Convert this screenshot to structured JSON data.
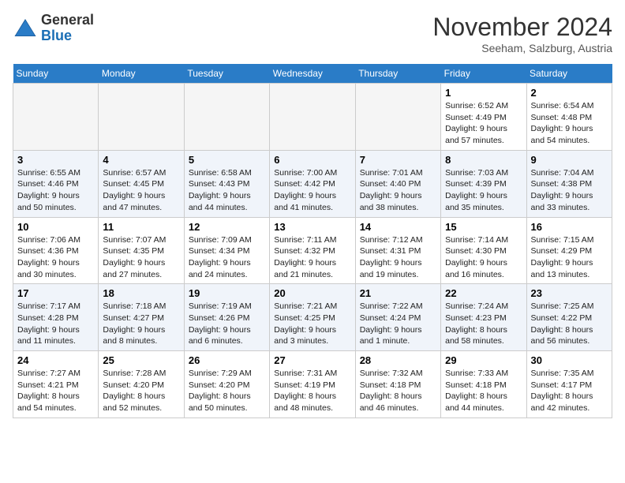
{
  "header": {
    "logo": {
      "general": "General",
      "blue": "Blue"
    },
    "title": "November 2024",
    "location": "Seeham, Salzburg, Austria"
  },
  "days_of_week": [
    "Sunday",
    "Monday",
    "Tuesday",
    "Wednesday",
    "Thursday",
    "Friday",
    "Saturday"
  ],
  "weeks": [
    [
      {
        "day": "",
        "info": ""
      },
      {
        "day": "",
        "info": ""
      },
      {
        "day": "",
        "info": ""
      },
      {
        "day": "",
        "info": ""
      },
      {
        "day": "",
        "info": ""
      },
      {
        "day": "1",
        "info": "Sunrise: 6:52 AM\nSunset: 4:49 PM\nDaylight: 9 hours\nand 57 minutes."
      },
      {
        "day": "2",
        "info": "Sunrise: 6:54 AM\nSunset: 4:48 PM\nDaylight: 9 hours\nand 54 minutes."
      }
    ],
    [
      {
        "day": "3",
        "info": "Sunrise: 6:55 AM\nSunset: 4:46 PM\nDaylight: 9 hours\nand 50 minutes."
      },
      {
        "day": "4",
        "info": "Sunrise: 6:57 AM\nSunset: 4:45 PM\nDaylight: 9 hours\nand 47 minutes."
      },
      {
        "day": "5",
        "info": "Sunrise: 6:58 AM\nSunset: 4:43 PM\nDaylight: 9 hours\nand 44 minutes."
      },
      {
        "day": "6",
        "info": "Sunrise: 7:00 AM\nSunset: 4:42 PM\nDaylight: 9 hours\nand 41 minutes."
      },
      {
        "day": "7",
        "info": "Sunrise: 7:01 AM\nSunset: 4:40 PM\nDaylight: 9 hours\nand 38 minutes."
      },
      {
        "day": "8",
        "info": "Sunrise: 7:03 AM\nSunset: 4:39 PM\nDaylight: 9 hours\nand 35 minutes."
      },
      {
        "day": "9",
        "info": "Sunrise: 7:04 AM\nSunset: 4:38 PM\nDaylight: 9 hours\nand 33 minutes."
      }
    ],
    [
      {
        "day": "10",
        "info": "Sunrise: 7:06 AM\nSunset: 4:36 PM\nDaylight: 9 hours\nand 30 minutes."
      },
      {
        "day": "11",
        "info": "Sunrise: 7:07 AM\nSunset: 4:35 PM\nDaylight: 9 hours\nand 27 minutes."
      },
      {
        "day": "12",
        "info": "Sunrise: 7:09 AM\nSunset: 4:34 PM\nDaylight: 9 hours\nand 24 minutes."
      },
      {
        "day": "13",
        "info": "Sunrise: 7:11 AM\nSunset: 4:32 PM\nDaylight: 9 hours\nand 21 minutes."
      },
      {
        "day": "14",
        "info": "Sunrise: 7:12 AM\nSunset: 4:31 PM\nDaylight: 9 hours\nand 19 minutes."
      },
      {
        "day": "15",
        "info": "Sunrise: 7:14 AM\nSunset: 4:30 PM\nDaylight: 9 hours\nand 16 minutes."
      },
      {
        "day": "16",
        "info": "Sunrise: 7:15 AM\nSunset: 4:29 PM\nDaylight: 9 hours\nand 13 minutes."
      }
    ],
    [
      {
        "day": "17",
        "info": "Sunrise: 7:17 AM\nSunset: 4:28 PM\nDaylight: 9 hours\nand 11 minutes."
      },
      {
        "day": "18",
        "info": "Sunrise: 7:18 AM\nSunset: 4:27 PM\nDaylight: 9 hours\nand 8 minutes."
      },
      {
        "day": "19",
        "info": "Sunrise: 7:19 AM\nSunset: 4:26 PM\nDaylight: 9 hours\nand 6 minutes."
      },
      {
        "day": "20",
        "info": "Sunrise: 7:21 AM\nSunset: 4:25 PM\nDaylight: 9 hours\nand 3 minutes."
      },
      {
        "day": "21",
        "info": "Sunrise: 7:22 AM\nSunset: 4:24 PM\nDaylight: 9 hours\nand 1 minute."
      },
      {
        "day": "22",
        "info": "Sunrise: 7:24 AM\nSunset: 4:23 PM\nDaylight: 8 hours\nand 58 minutes."
      },
      {
        "day": "23",
        "info": "Sunrise: 7:25 AM\nSunset: 4:22 PM\nDaylight: 8 hours\nand 56 minutes."
      }
    ],
    [
      {
        "day": "24",
        "info": "Sunrise: 7:27 AM\nSunset: 4:21 PM\nDaylight: 8 hours\nand 54 minutes."
      },
      {
        "day": "25",
        "info": "Sunrise: 7:28 AM\nSunset: 4:20 PM\nDaylight: 8 hours\nand 52 minutes."
      },
      {
        "day": "26",
        "info": "Sunrise: 7:29 AM\nSunset: 4:20 PM\nDaylight: 8 hours\nand 50 minutes."
      },
      {
        "day": "27",
        "info": "Sunrise: 7:31 AM\nSunset: 4:19 PM\nDaylight: 8 hours\nand 48 minutes."
      },
      {
        "day": "28",
        "info": "Sunrise: 7:32 AM\nSunset: 4:18 PM\nDaylight: 8 hours\nand 46 minutes."
      },
      {
        "day": "29",
        "info": "Sunrise: 7:33 AM\nSunset: 4:18 PM\nDaylight: 8 hours\nand 44 minutes."
      },
      {
        "day": "30",
        "info": "Sunrise: 7:35 AM\nSunset: 4:17 PM\nDaylight: 8 hours\nand 42 minutes."
      }
    ]
  ]
}
